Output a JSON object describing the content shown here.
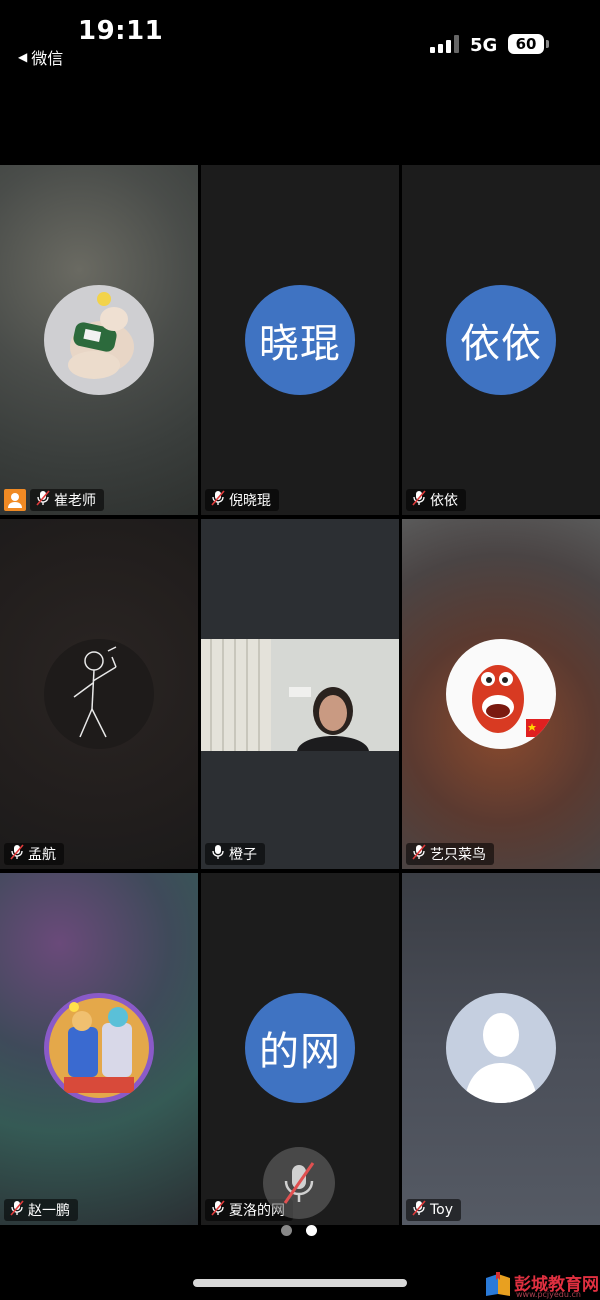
{
  "status_bar": {
    "time": "19:11",
    "back_label": "微信",
    "network": "5G",
    "battery": "60"
  },
  "participants": [
    {
      "name": "崔老师",
      "muted": true,
      "host": true,
      "avatar": "puppy-photo"
    },
    {
      "name": "倪晓琨",
      "muted": true,
      "avatar_text": "晓琨"
    },
    {
      "name": "依依",
      "muted": true,
      "avatar_text": "依依"
    },
    {
      "name": "孟航",
      "muted": true,
      "avatar": "stick-figure-drawing"
    },
    {
      "name": "橙子",
      "muted": false,
      "video": true
    },
    {
      "name": "艺只菜鸟",
      "muted": true,
      "avatar": "red-cartoon-worm"
    },
    {
      "name": "赵一鹏",
      "muted": true,
      "avatar": "colorful-cartoon-heroes"
    },
    {
      "name": "夏洛的网",
      "muted": true,
      "avatar_text": "的网"
    },
    {
      "name": "Toy",
      "muted": true,
      "avatar": "default-person-silhouette"
    }
  ],
  "pagination": {
    "total": 2,
    "current": 2
  },
  "watermark": {
    "text": "彭城教育网",
    "url": "www.pcjyedu.cn"
  },
  "colors": {
    "avatar_blue": "#3f73c2",
    "host_badge": "#f08a24"
  }
}
